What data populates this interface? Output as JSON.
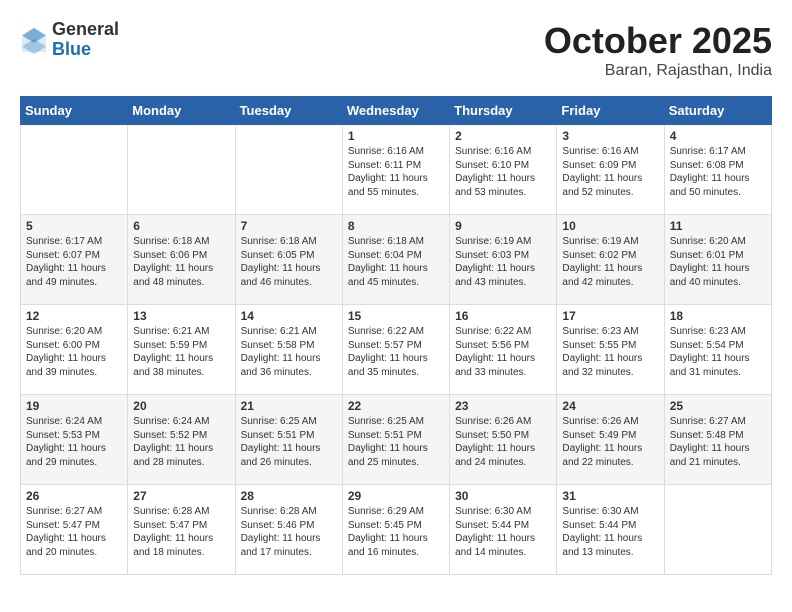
{
  "header": {
    "logo_general": "General",
    "logo_blue": "Blue",
    "month_title": "October 2025",
    "subtitle": "Baran, Rajasthan, India"
  },
  "days_of_week": [
    "Sunday",
    "Monday",
    "Tuesday",
    "Wednesday",
    "Thursday",
    "Friday",
    "Saturday"
  ],
  "weeks": [
    [
      {
        "day": "",
        "info": ""
      },
      {
        "day": "",
        "info": ""
      },
      {
        "day": "",
        "info": ""
      },
      {
        "day": "1",
        "info": "Sunrise: 6:16 AM\nSunset: 6:11 PM\nDaylight: 11 hours\nand 55 minutes."
      },
      {
        "day": "2",
        "info": "Sunrise: 6:16 AM\nSunset: 6:10 PM\nDaylight: 11 hours\nand 53 minutes."
      },
      {
        "day": "3",
        "info": "Sunrise: 6:16 AM\nSunset: 6:09 PM\nDaylight: 11 hours\nand 52 minutes."
      },
      {
        "day": "4",
        "info": "Sunrise: 6:17 AM\nSunset: 6:08 PM\nDaylight: 11 hours\nand 50 minutes."
      }
    ],
    [
      {
        "day": "5",
        "info": "Sunrise: 6:17 AM\nSunset: 6:07 PM\nDaylight: 11 hours\nand 49 minutes."
      },
      {
        "day": "6",
        "info": "Sunrise: 6:18 AM\nSunset: 6:06 PM\nDaylight: 11 hours\nand 48 minutes."
      },
      {
        "day": "7",
        "info": "Sunrise: 6:18 AM\nSunset: 6:05 PM\nDaylight: 11 hours\nand 46 minutes."
      },
      {
        "day": "8",
        "info": "Sunrise: 6:18 AM\nSunset: 6:04 PM\nDaylight: 11 hours\nand 45 minutes."
      },
      {
        "day": "9",
        "info": "Sunrise: 6:19 AM\nSunset: 6:03 PM\nDaylight: 11 hours\nand 43 minutes."
      },
      {
        "day": "10",
        "info": "Sunrise: 6:19 AM\nSunset: 6:02 PM\nDaylight: 11 hours\nand 42 minutes."
      },
      {
        "day": "11",
        "info": "Sunrise: 6:20 AM\nSunset: 6:01 PM\nDaylight: 11 hours\nand 40 minutes."
      }
    ],
    [
      {
        "day": "12",
        "info": "Sunrise: 6:20 AM\nSunset: 6:00 PM\nDaylight: 11 hours\nand 39 minutes."
      },
      {
        "day": "13",
        "info": "Sunrise: 6:21 AM\nSunset: 5:59 PM\nDaylight: 11 hours\nand 38 minutes."
      },
      {
        "day": "14",
        "info": "Sunrise: 6:21 AM\nSunset: 5:58 PM\nDaylight: 11 hours\nand 36 minutes."
      },
      {
        "day": "15",
        "info": "Sunrise: 6:22 AM\nSunset: 5:57 PM\nDaylight: 11 hours\nand 35 minutes."
      },
      {
        "day": "16",
        "info": "Sunrise: 6:22 AM\nSunset: 5:56 PM\nDaylight: 11 hours\nand 33 minutes."
      },
      {
        "day": "17",
        "info": "Sunrise: 6:23 AM\nSunset: 5:55 PM\nDaylight: 11 hours\nand 32 minutes."
      },
      {
        "day": "18",
        "info": "Sunrise: 6:23 AM\nSunset: 5:54 PM\nDaylight: 11 hours\nand 31 minutes."
      }
    ],
    [
      {
        "day": "19",
        "info": "Sunrise: 6:24 AM\nSunset: 5:53 PM\nDaylight: 11 hours\nand 29 minutes."
      },
      {
        "day": "20",
        "info": "Sunrise: 6:24 AM\nSunset: 5:52 PM\nDaylight: 11 hours\nand 28 minutes."
      },
      {
        "day": "21",
        "info": "Sunrise: 6:25 AM\nSunset: 5:51 PM\nDaylight: 11 hours\nand 26 minutes."
      },
      {
        "day": "22",
        "info": "Sunrise: 6:25 AM\nSunset: 5:51 PM\nDaylight: 11 hours\nand 25 minutes."
      },
      {
        "day": "23",
        "info": "Sunrise: 6:26 AM\nSunset: 5:50 PM\nDaylight: 11 hours\nand 24 minutes."
      },
      {
        "day": "24",
        "info": "Sunrise: 6:26 AM\nSunset: 5:49 PM\nDaylight: 11 hours\nand 22 minutes."
      },
      {
        "day": "25",
        "info": "Sunrise: 6:27 AM\nSunset: 5:48 PM\nDaylight: 11 hours\nand 21 minutes."
      }
    ],
    [
      {
        "day": "26",
        "info": "Sunrise: 6:27 AM\nSunset: 5:47 PM\nDaylight: 11 hours\nand 20 minutes."
      },
      {
        "day": "27",
        "info": "Sunrise: 6:28 AM\nSunset: 5:47 PM\nDaylight: 11 hours\nand 18 minutes."
      },
      {
        "day": "28",
        "info": "Sunrise: 6:28 AM\nSunset: 5:46 PM\nDaylight: 11 hours\nand 17 minutes."
      },
      {
        "day": "29",
        "info": "Sunrise: 6:29 AM\nSunset: 5:45 PM\nDaylight: 11 hours\nand 16 minutes."
      },
      {
        "day": "30",
        "info": "Sunrise: 6:30 AM\nSunset: 5:44 PM\nDaylight: 11 hours\nand 14 minutes."
      },
      {
        "day": "31",
        "info": "Sunrise: 6:30 AM\nSunset: 5:44 PM\nDaylight: 11 hours\nand 13 minutes."
      },
      {
        "day": "",
        "info": ""
      }
    ]
  ]
}
